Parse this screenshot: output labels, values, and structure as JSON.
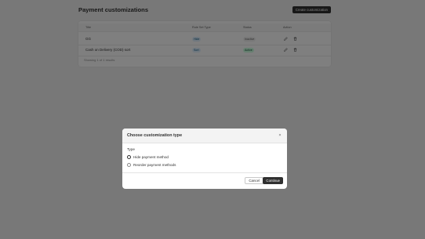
{
  "page": {
    "title": "Payment customizations",
    "create_button": "Create customization"
  },
  "table": {
    "headers": [
      "Title",
      "Rule Set Type",
      "Status",
      "Action"
    ],
    "rows": [
      {
        "title": "GG",
        "rule_type": "Hide",
        "status": "Inactive"
      },
      {
        "title": "Cash on Delivery (COD) sort",
        "rule_type": "Sort",
        "status": "Active"
      }
    ],
    "footer": "Showing 1 of 1 results"
  },
  "modal": {
    "title": "Choose customization type",
    "close_glyph": "×",
    "section_label": "Type",
    "options": [
      {
        "label": "Hide payment method",
        "selected": true
      },
      {
        "label": "Reorder payment methods",
        "selected": false
      }
    ],
    "cancel": "Cancel",
    "continue": "Continue"
  },
  "colors": {
    "hide_badge_bg": "#e0f0ff",
    "sort_badge_bg": "#e0f0ff",
    "inactive_badge_bg": "#f1f1f1",
    "active_badge_bg": "#cdfee1",
    "active_badge_text": "#0c5132",
    "overlay": "rgba(0,0,0,0.5)"
  },
  "icons": {
    "edit": "pencil-icon",
    "delete": "trash-icon",
    "close": "close-icon"
  }
}
